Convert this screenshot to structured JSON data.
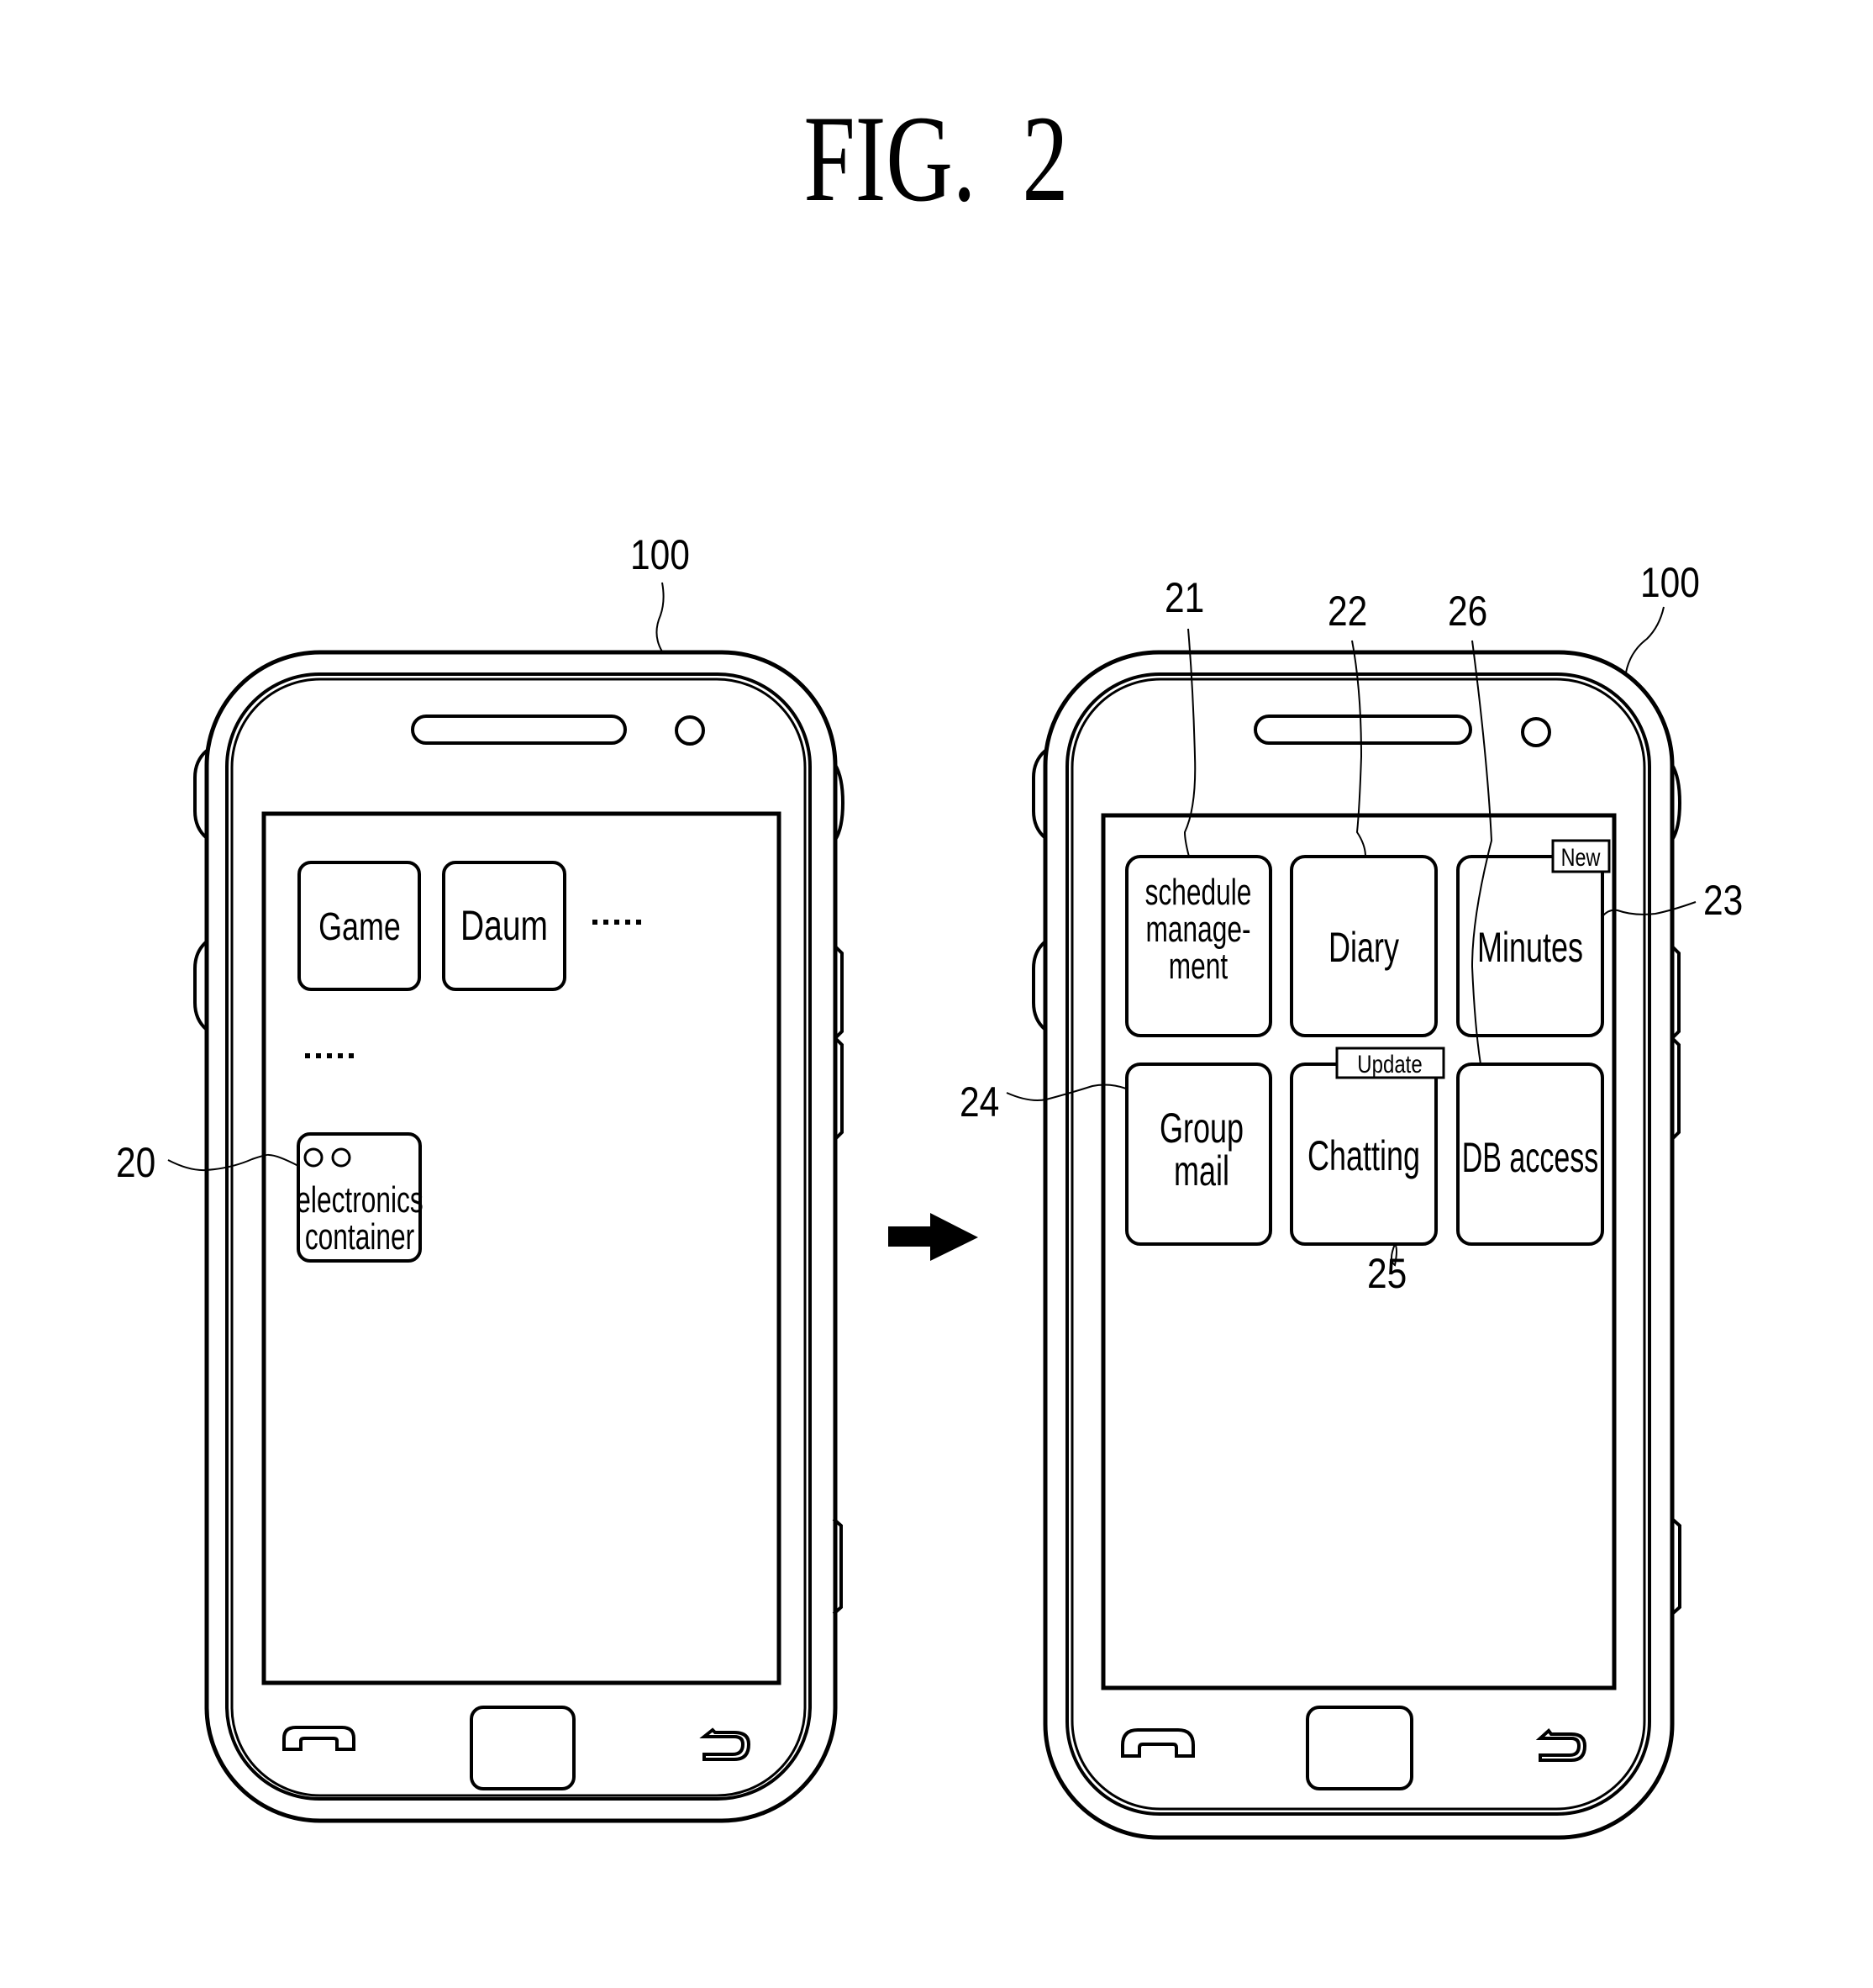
{
  "figure": {
    "title": "FIG.  2",
    "arrow_direction": "right"
  },
  "left_phone": {
    "reference_label": "100",
    "apps": [
      {
        "label_lines": [
          "Game"
        ]
      },
      {
        "label_lines": [
          "Daum"
        ]
      }
    ],
    "ellipsis_row1": ".....",
    "ellipsis_row2": ".....",
    "container": {
      "reference_label": "20",
      "icon": "two-circles-icon",
      "label_lines": [
        "electronics",
        "container"
      ]
    },
    "nav": {
      "left_icon": "call-icon",
      "center_icon": "home-button",
      "right_icon": "back-icon"
    }
  },
  "right_phone": {
    "reference_label": "100",
    "apps": [
      {
        "ref": "21",
        "label_lines": [
          "schedule",
          "manage-",
          "ment"
        ],
        "badge": null
      },
      {
        "ref": "22",
        "label_lines": [
          "Diary"
        ],
        "badge": null
      },
      {
        "ref": "23",
        "label_lines": [
          "Minutes"
        ],
        "badge": "New"
      },
      {
        "ref": "24",
        "label_lines": [
          "Group",
          "mail"
        ],
        "badge": null
      },
      {
        "ref": "25",
        "label_lines": [
          "Chatting"
        ],
        "badge": "Update"
      },
      {
        "ref": "26",
        "label_lines": [
          "DB access"
        ],
        "badge": null
      }
    ],
    "nav": {
      "left_icon": "call-icon",
      "center_icon": "home-button",
      "right_icon": "back-icon"
    }
  },
  "colors": {
    "ink": "#000000",
    "paper": "#ffffff"
  }
}
